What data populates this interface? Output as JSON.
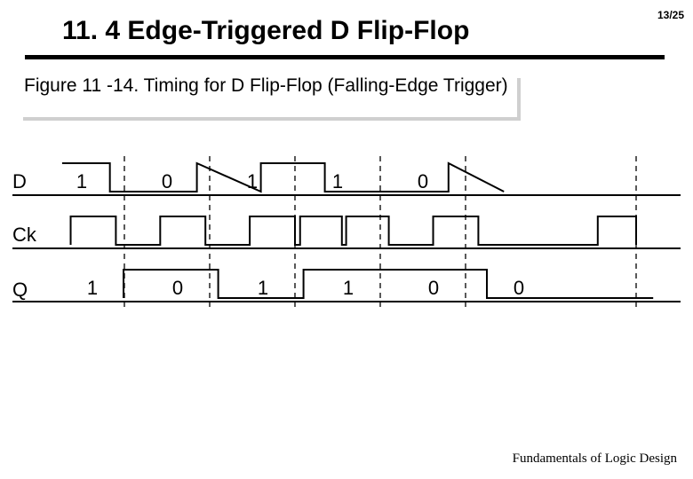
{
  "page_number": "13/25",
  "title": "11. 4  Edge-Triggered D Flip-Flop",
  "caption": "Figure 11 -14. Timing for D Flip-Flop (Falling-Edge Trigger)",
  "footer": "Fundamentals of Logic Design",
  "signals": {
    "D": {
      "label": "D"
    },
    "Ck": {
      "label": "Ck"
    },
    "Q": {
      "label": "Q"
    }
  },
  "chart_data": {
    "type": "timing",
    "time_axis": [
      0,
      1,
      2,
      3,
      4,
      5,
      6,
      7
    ],
    "dashed_markers_at": [
      1,
      2,
      3,
      4,
      5,
      7
    ],
    "signals": [
      {
        "name": "D",
        "display_values": [
          "1",
          "0",
          "1",
          "1",
          "0",
          "",
          ""
        ],
        "levels": [
          1,
          1,
          0,
          0,
          1,
          0,
          1,
          1,
          0,
          0,
          1,
          0
        ],
        "segment_x": [
          0.27,
          0.83,
          0.83,
          1.85,
          1.85,
          2.6,
          2.6,
          3.35,
          3.35,
          4.8,
          4.8,
          5.45
        ]
      },
      {
        "name": "Ck",
        "display_values": [],
        "levels": [
          0,
          1,
          1,
          0,
          0,
          1,
          1,
          0,
          0,
          1,
          1,
          0,
          0,
          1,
          1,
          0,
          0,
          1,
          1,
          0,
          0,
          1,
          1,
          0,
          0,
          1,
          1,
          0
        ],
        "segment_x": [
          0.37,
          0.37,
          0.9,
          0.9,
          1.42,
          1.42,
          1.95,
          1.95,
          2.47,
          2.47,
          3.0,
          3.0,
          3.06,
          3.06,
          3.55,
          3.55,
          3.6,
          3.6,
          4.1,
          4.1,
          4.62,
          4.62,
          5.15,
          5.15,
          6.55,
          6.55,
          7.0,
          7.0
        ]
      },
      {
        "name": "Q",
        "display_values": [
          "1",
          "0",
          "1",
          "1",
          "0",
          "0"
        ],
        "levels": [
          0,
          1,
          1,
          0,
          0,
          1,
          1,
          0,
          0
        ],
        "segment_x": [
          0.99,
          0.99,
          2.1,
          2.1,
          3.1,
          3.1,
          5.25,
          5.25,
          7.2
        ]
      }
    ]
  }
}
